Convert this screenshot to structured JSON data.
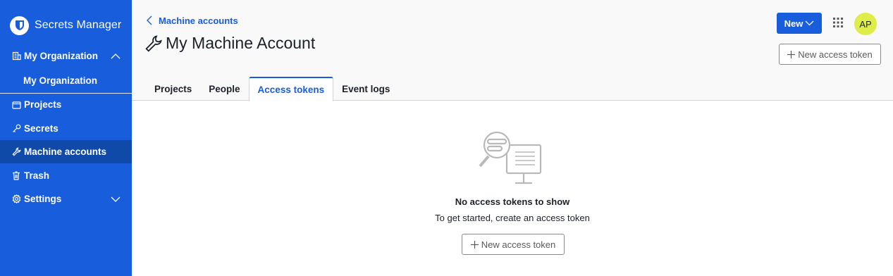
{
  "app": {
    "name": "Secrets Manager"
  },
  "sidebar": {
    "org_label": "My Organization",
    "org_sub_label": "My Organization",
    "items": [
      {
        "label": "Projects",
        "icon": "folder-icon"
      },
      {
        "label": "Secrets",
        "icon": "key-icon"
      },
      {
        "label": "Machine accounts",
        "icon": "wrench-icon",
        "active": true
      },
      {
        "label": "Trash",
        "icon": "trash-icon"
      },
      {
        "label": "Settings",
        "icon": "gear-icon"
      }
    ]
  },
  "header": {
    "breadcrumb": "Machine accounts",
    "title": "My Machine Account",
    "new_button": "New",
    "avatar_initials": "AP",
    "new_token_button": "New access token"
  },
  "tabs": [
    {
      "label": "Projects"
    },
    {
      "label": "People"
    },
    {
      "label": "Access tokens",
      "active": true
    },
    {
      "label": "Event logs"
    }
  ],
  "empty_state": {
    "title": "No access tokens to show",
    "subtitle": "To get started, create an access token",
    "button": "New access token"
  },
  "colors": {
    "brand": "#175ddc",
    "active_nav": "#0f4aa8",
    "avatar": "#dfed4a"
  }
}
